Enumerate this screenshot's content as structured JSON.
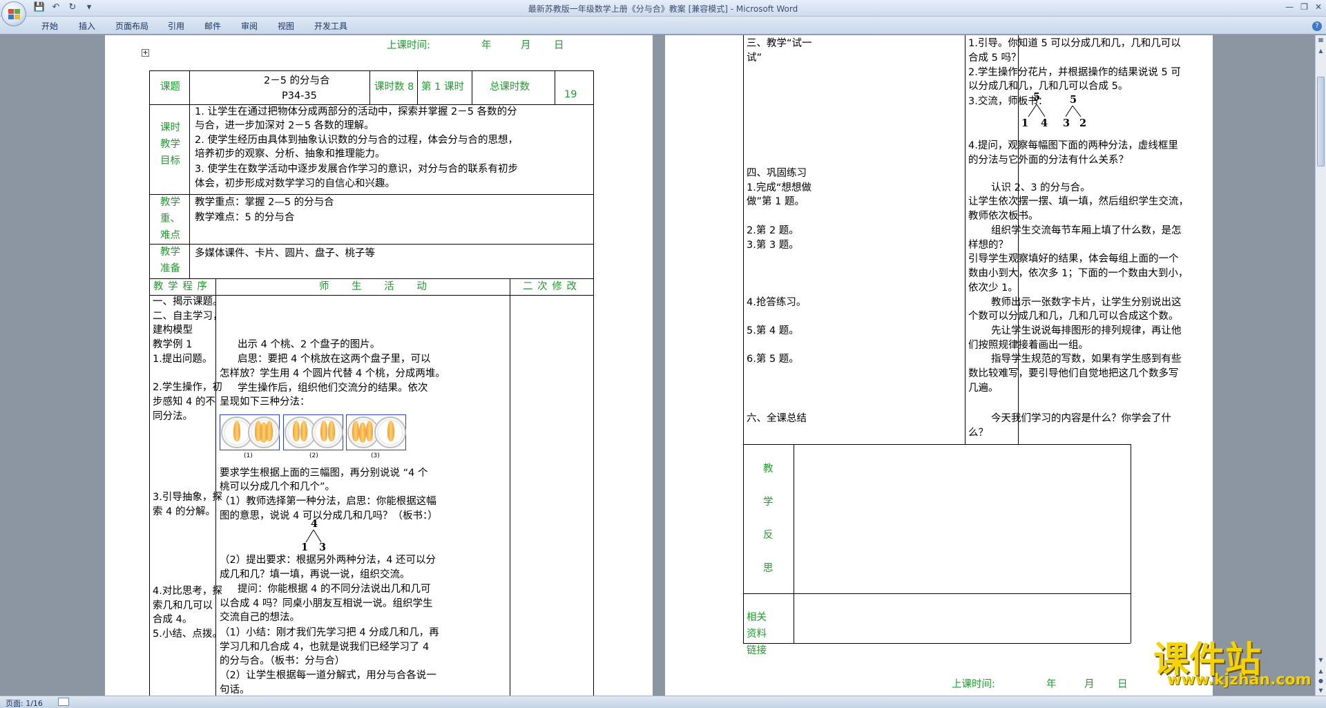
{
  "window": {
    "title": "最新苏教版一年级数学上册《分与合》教案 [兼容模式] - Microsoft Word"
  },
  "ribbon": {
    "tabs": [
      "开始",
      "插入",
      "页面布局",
      "引用",
      "邮件",
      "审阅",
      "视图",
      "开发工具"
    ]
  },
  "status": {
    "page": "页面: 1/16"
  },
  "page1": {
    "header": {
      "label": "上课时间:",
      "year": "年",
      "month": "月",
      "day": "日"
    },
    "row1": {
      "topic_label": "课题",
      "topic": "2－5 的分与合",
      "topic_pages": "P34-35",
      "hours_label": "课时数 8",
      "lesson": "第 1 课时",
      "total_label": "总课时数",
      "total": "19"
    },
    "objectives": {
      "label": [
        "课时",
        "教学",
        "目标"
      ],
      "lines": [
        "1. 让学生在通过把物体分成两部分的活动中，探索并掌握 2－5 各数的分",
        "与合，进一步加深对 2－5 各数的理解。",
        "2. 使学生经历由具体到抽象认识数的分与合的过程，体会分与合的思想，",
        "培养初步的观察、分析、抽象和推理能力。",
        "3. 使学生在数学活动中逐步发展合作学习的意识，对分与合的联系有初步",
        "体会，初步形成对数学学习的自信心和兴趣。"
      ]
    },
    "keypoints": {
      "label": [
        "教学",
        "重、",
        "难点"
      ],
      "lines": [
        "教学重点：掌握 2—5 的分与合",
        "教学难点：5 的分与合"
      ]
    },
    "prep": {
      "label": [
        "教学",
        "准备"
      ],
      "text": "多媒体课件、卡片、圆片、盘子、桃子等"
    },
    "section_headers": {
      "procedure": "教 学 程 序",
      "activity": "师 生 活 动",
      "revise": "二 次 修 改"
    },
    "procedure": [
      "一、揭示课题。",
      "二、自主学习，",
      "建构模型",
      "教学例 1",
      "1.提出问题。",
      "2.学生操作，初",
      "步感知 4 的不",
      "同分法。",
      "3.引导抽象，探",
      "索 4 的分解。",
      "4.对比思考，探",
      "索几和几可以",
      "合成 4。",
      "5.小结、点拨。"
    ],
    "activity": [
      "出示 4 个桃、2 个盘子的图片。",
      "启思：要把 4 个桃放在这两个盘子里，可以",
      "怎样放？学生用 4 个圆片代替 4 个桃，分成两堆。",
      "学生操作后，组织他们交流分的结果。依次",
      "呈现如下三种分法：",
      "要求学生根据上面的三幅图，再分别说说 “4 个",
      "桃可以分成几个和几个”。",
      "（1）教师选择第一种分法，启思：你能根据这幅",
      "图的意思，说说 4 可以分成几和几吗？（板书：）",
      "（2）提出要求：根据另外两种分法，4 还可以分",
      "成几和几？填一填，再说一说，组织交流。",
      "提问：你能根据 4 的不同分法说出几和几可",
      "以合成 4 吗？同桌小朋友互相说一说。组织学生",
      "交流自己的想法。",
      "（1）小结：刚才我们先学习把 4 分成几和几，再",
      "学习几和几合成 4，也就是说我们已经学习了 4",
      "的分与合。（板书：分与合）",
      "（2）让学生根据每一道分解式，用分与合各说一",
      "句话。"
    ],
    "fig_labels": [
      "(1)",
      "(2)",
      "(3)"
    ],
    "tree4": {
      "top": "4",
      "left": "1",
      "right": "3"
    }
  },
  "page2": {
    "left_col": [
      "三、教学“试一",
      "试”",
      "四、巩固练习",
      "1.完成“想想做",
      "做”第 1 题。",
      "2.第 2 题。",
      "3.第 3 题。",
      "4.抢答练习。",
      "5.第 4 题。",
      "6.第 5 题。",
      "六、全课总结"
    ],
    "right_col": [
      "1.引导。你知道 5 可以分成几和几，几和几可以",
      "合成 5 吗？",
      "2.学生操作分花片，并根据操作的结果说说 5 可",
      "以分成几和几，几和几可以合成 5。",
      "3.交流，师板书：",
      "4.提问，观察每幅图下面的两种分法，虚线框里",
      "的分法与它外面的分法有什么关系？",
      "认识 2、3 的分与合。",
      "让学生依次摆一摆、填一填，然后组织学生交流，",
      "教师依次板书。",
      "组织学生交流每节车厢上填了什么数，是怎",
      "样想的？",
      "引导学生观察填好的结果，体会每组上面的一个",
      "数由小到大，依次多 1；下面的一个数由大到小，",
      "依次少 1。",
      "教师出示一张数字卡片，让学生分别说出这",
      "个数可以分成几和几，几和几可以合成这个数。",
      "先让学生说说每排图形的排列规律，再让他",
      "们按照规律接着画出一组。",
      "指导学生规范的写数，如果有学生感到有些",
      "数比较难写，要引导他们自觉地把这几个数多写",
      "几遍。",
      "今天我们学习的内容是什么？你学会了什",
      "么？"
    ],
    "tree5a": {
      "top": "5",
      "left": "1",
      "right": "4"
    },
    "tree5b": {
      "top": "5",
      "left": "3",
      "right": "2"
    },
    "reflection_label": [
      "教",
      "学",
      "反",
      "思"
    ],
    "resources_label": [
      "相关",
      "资料",
      "链接"
    ],
    "footer": {
      "label": "上课时间:",
      "year": "年",
      "month": "月",
      "day": "日"
    }
  },
  "watermark": {
    "cn": "课件站",
    "url": "www.kjzhan.com"
  }
}
